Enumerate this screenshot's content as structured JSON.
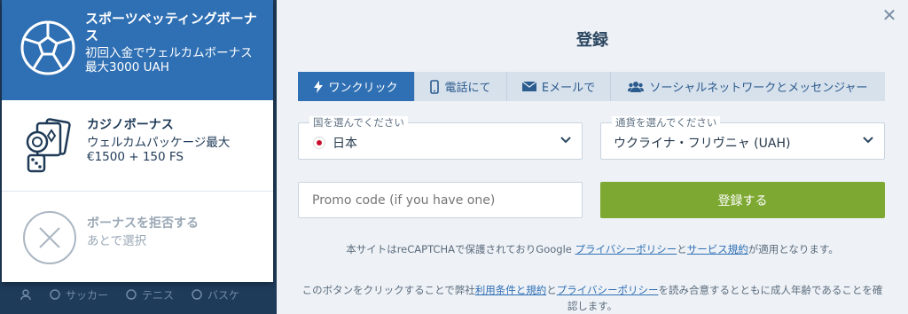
{
  "background_nav": {
    "items": [
      "サッカー",
      "テニス",
      "バスケ"
    ]
  },
  "bonuses": {
    "sports": {
      "title": "スポーツベッティングボーナス",
      "desc": "初回入金でウェルカムボーナス最大3000 UAH",
      "icon": "soccer-ball-icon"
    },
    "casino": {
      "title": "カジノボーナス",
      "desc": "ウェルカムパッケージ最大 €1500 + 150 FS",
      "icon": "casino-chips-cards-dice-icon"
    },
    "decline": {
      "title": "ボーナスを拒否する",
      "desc": "あとで選択",
      "icon": "decline-x-icon"
    }
  },
  "modal": {
    "title": "登録",
    "close_icon": "close-icon",
    "tabs": [
      {
        "label": "ワンクリック",
        "icon": "lightning-icon",
        "active": true
      },
      {
        "label": "電話にて",
        "icon": "phone-icon",
        "active": false
      },
      {
        "label": "Eメールで",
        "icon": "envelope-icon",
        "active": false
      },
      {
        "label": "ソーシャルネットワークとメッセンジャー",
        "icon": "users-icon",
        "active": false
      }
    ],
    "country": {
      "label": "国を選んでください",
      "value": "日本"
    },
    "currency": {
      "label": "通貨を選んでください",
      "value": "ウクライナ・フリヴニャ (UAH)"
    },
    "promo": {
      "placeholder": "Promo code (if you have one)"
    },
    "submit_label": "登録する",
    "recaptcha": {
      "pre": "本サイトはreCAPTCHAで保護されておりGoogle ",
      "privacy": "プライバシーポリシー",
      "and": "と",
      "terms": "サービス規約",
      "post": "が適用となります。"
    },
    "agreement": {
      "pre": "このボタンをクリックすることで弊社",
      "terms": "利用条件と規約",
      "and": "と",
      "privacy": "プライバシーポリシー",
      "post": "を読み合意するとともに成人年齢であることを確認します。"
    }
  },
  "colors": {
    "brand_blue": "#2f6fb3",
    "submit_green": "#7da832",
    "background_dark": "#1f3a57"
  }
}
